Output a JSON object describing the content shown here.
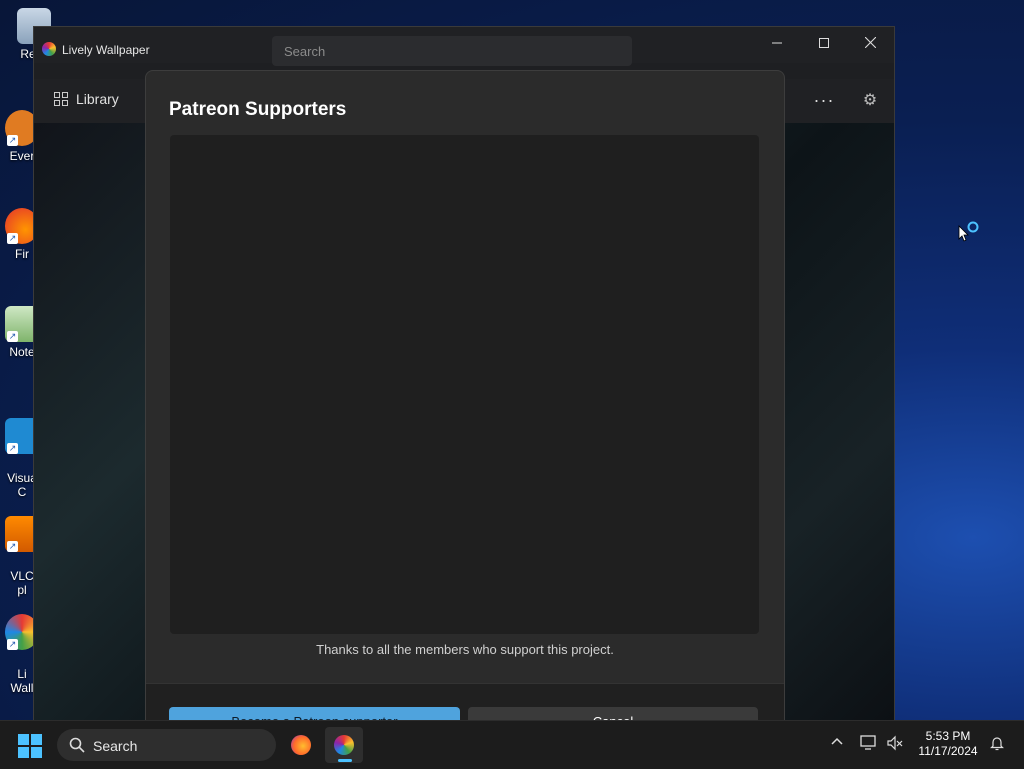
{
  "desktop": {
    "icons": [
      {
        "label": "Recy",
        "name": "recycle-bin"
      },
      {
        "label": "Ever",
        "name": "everything"
      },
      {
        "label": "Fir",
        "name": "firefox"
      },
      {
        "label": "Note",
        "name": "notepad"
      },
      {
        "label": "Visua\nC",
        "name": "visual-studio-code"
      },
      {
        "label": "VLC\npl",
        "name": "vlc-player"
      },
      {
        "label": "Li\nWall",
        "name": "lively-wallpaper"
      }
    ]
  },
  "window": {
    "title": "Lively Wallpaper",
    "search_placeholder": "Search",
    "nav_library": "Library",
    "more_glyph": "···",
    "settings_glyph": "⚙"
  },
  "dialog": {
    "title": "Patreon Supporters",
    "thanks": "Thanks to all the members who support this project.",
    "primary_button": "Become a Patreon supporter",
    "secondary_button": "Cancel"
  },
  "taskbar": {
    "search_label": "Search",
    "time": "5:53 PM",
    "date": "11/17/2024"
  },
  "colors": {
    "accent": "#4cc2ff",
    "primary_button": "#4fa3dd"
  }
}
